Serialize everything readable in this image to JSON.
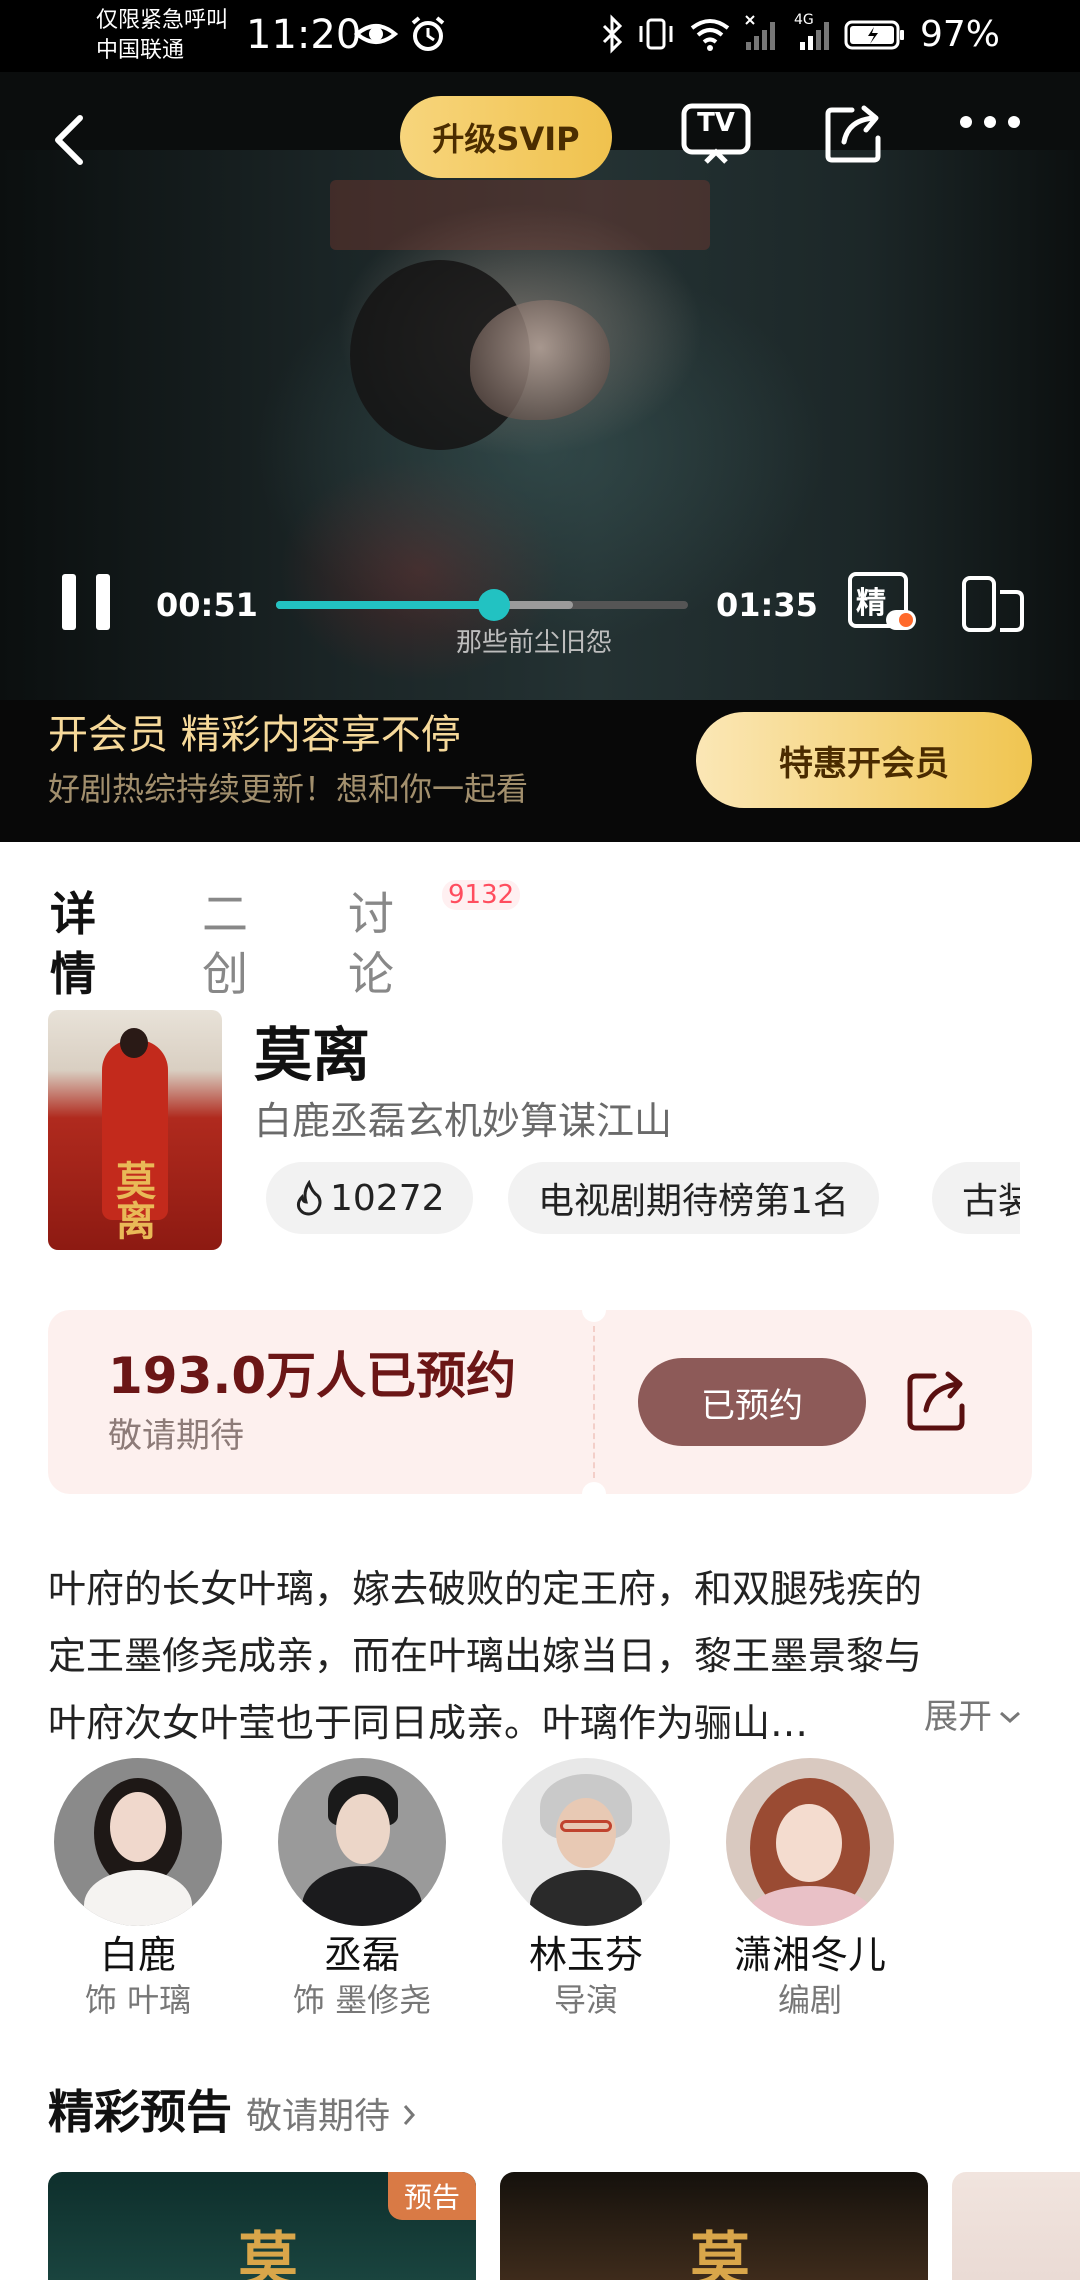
{
  "status_bar": {
    "carrier_line1": "仅限紧急呼叫",
    "carrier_line2": "中国联通",
    "time": "11:20",
    "battery": "97%",
    "network": "4G"
  },
  "player": {
    "svip_label": "升级SVIP",
    "tv_label": "TV",
    "current_time": "00:51",
    "total_time": "01:35",
    "chapter": "那些前尘旧怨",
    "progress": 0.53,
    "buffered": 0.72,
    "jing_label": "精"
  },
  "vip_banner": {
    "title": "开会员 精彩内容享不停",
    "subtitle": "好剧热综持续更新！想和你一起看",
    "button": "特惠开会员"
  },
  "tabs": [
    {
      "label": "详情",
      "active": true
    },
    {
      "label": "二创",
      "active": false
    },
    {
      "label": "讨论",
      "active": false
    }
  ],
  "discussion_count": "9132",
  "show": {
    "poster_text": "莫离",
    "title": "莫离",
    "subtitle": "白鹿丞磊玄机妙算谋江山",
    "heat": "10272",
    "tags": [
      "电视剧期待榜第1名",
      "古装"
    ]
  },
  "reservation": {
    "count": "193.0万人已预约",
    "note": "敬请期待",
    "button": "已预约"
  },
  "synopsis": {
    "lines": [
      "叶府的长女叶璃，嫁去破败的定王府，和双腿残疾的",
      "定王墨修尧成亲，而在叶璃出嫁当日，黎王墨景黎与",
      "叶府次女叶莹也于同日成亲。叶璃作为骊山…"
    ],
    "expand": "展开"
  },
  "cast": [
    {
      "name": "白鹿",
      "role": "饰 叶璃"
    },
    {
      "name": "丞磊",
      "role": "饰 墨修尧"
    },
    {
      "name": "林玉芬",
      "role": "导演"
    },
    {
      "name": "潇湘冬儿",
      "role": "编剧"
    }
  ],
  "trailers": {
    "title": "精彩预告",
    "more": "敬请期待",
    "badge": "预告",
    "card_glyph": "莫"
  },
  "colors": {
    "accent_teal": "#22c2c2",
    "gold": "#f0c24e",
    "reserve_bg": "#fdf0ee",
    "reserve_btn": "#8d5a58",
    "badge_red": "#ff4d5e"
  }
}
